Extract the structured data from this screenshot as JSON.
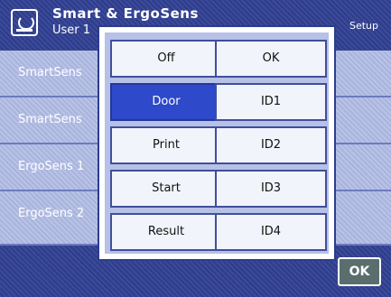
{
  "header": {
    "title": "Smart & ErgoSens",
    "subtitle": "User 1",
    "right_text": "Setup"
  },
  "rows": [
    {
      "label": "SmartSens"
    },
    {
      "label": "SmartSens"
    },
    {
      "label": "ErgoSens 1"
    },
    {
      "label": "ErgoSens 2"
    }
  ],
  "footer": {
    "ok_label": "OK"
  },
  "popup": {
    "options_left": [
      "Off",
      "Door",
      "Print",
      "Start",
      "Result"
    ],
    "options_right": [
      "OK",
      "ID1",
      "ID2",
      "ID3",
      "ID4"
    ],
    "selected": "Door"
  },
  "colors": {
    "header": "#3b4a9c",
    "selected": "#2e49c9",
    "popup_bg": "#b7c0e6"
  }
}
